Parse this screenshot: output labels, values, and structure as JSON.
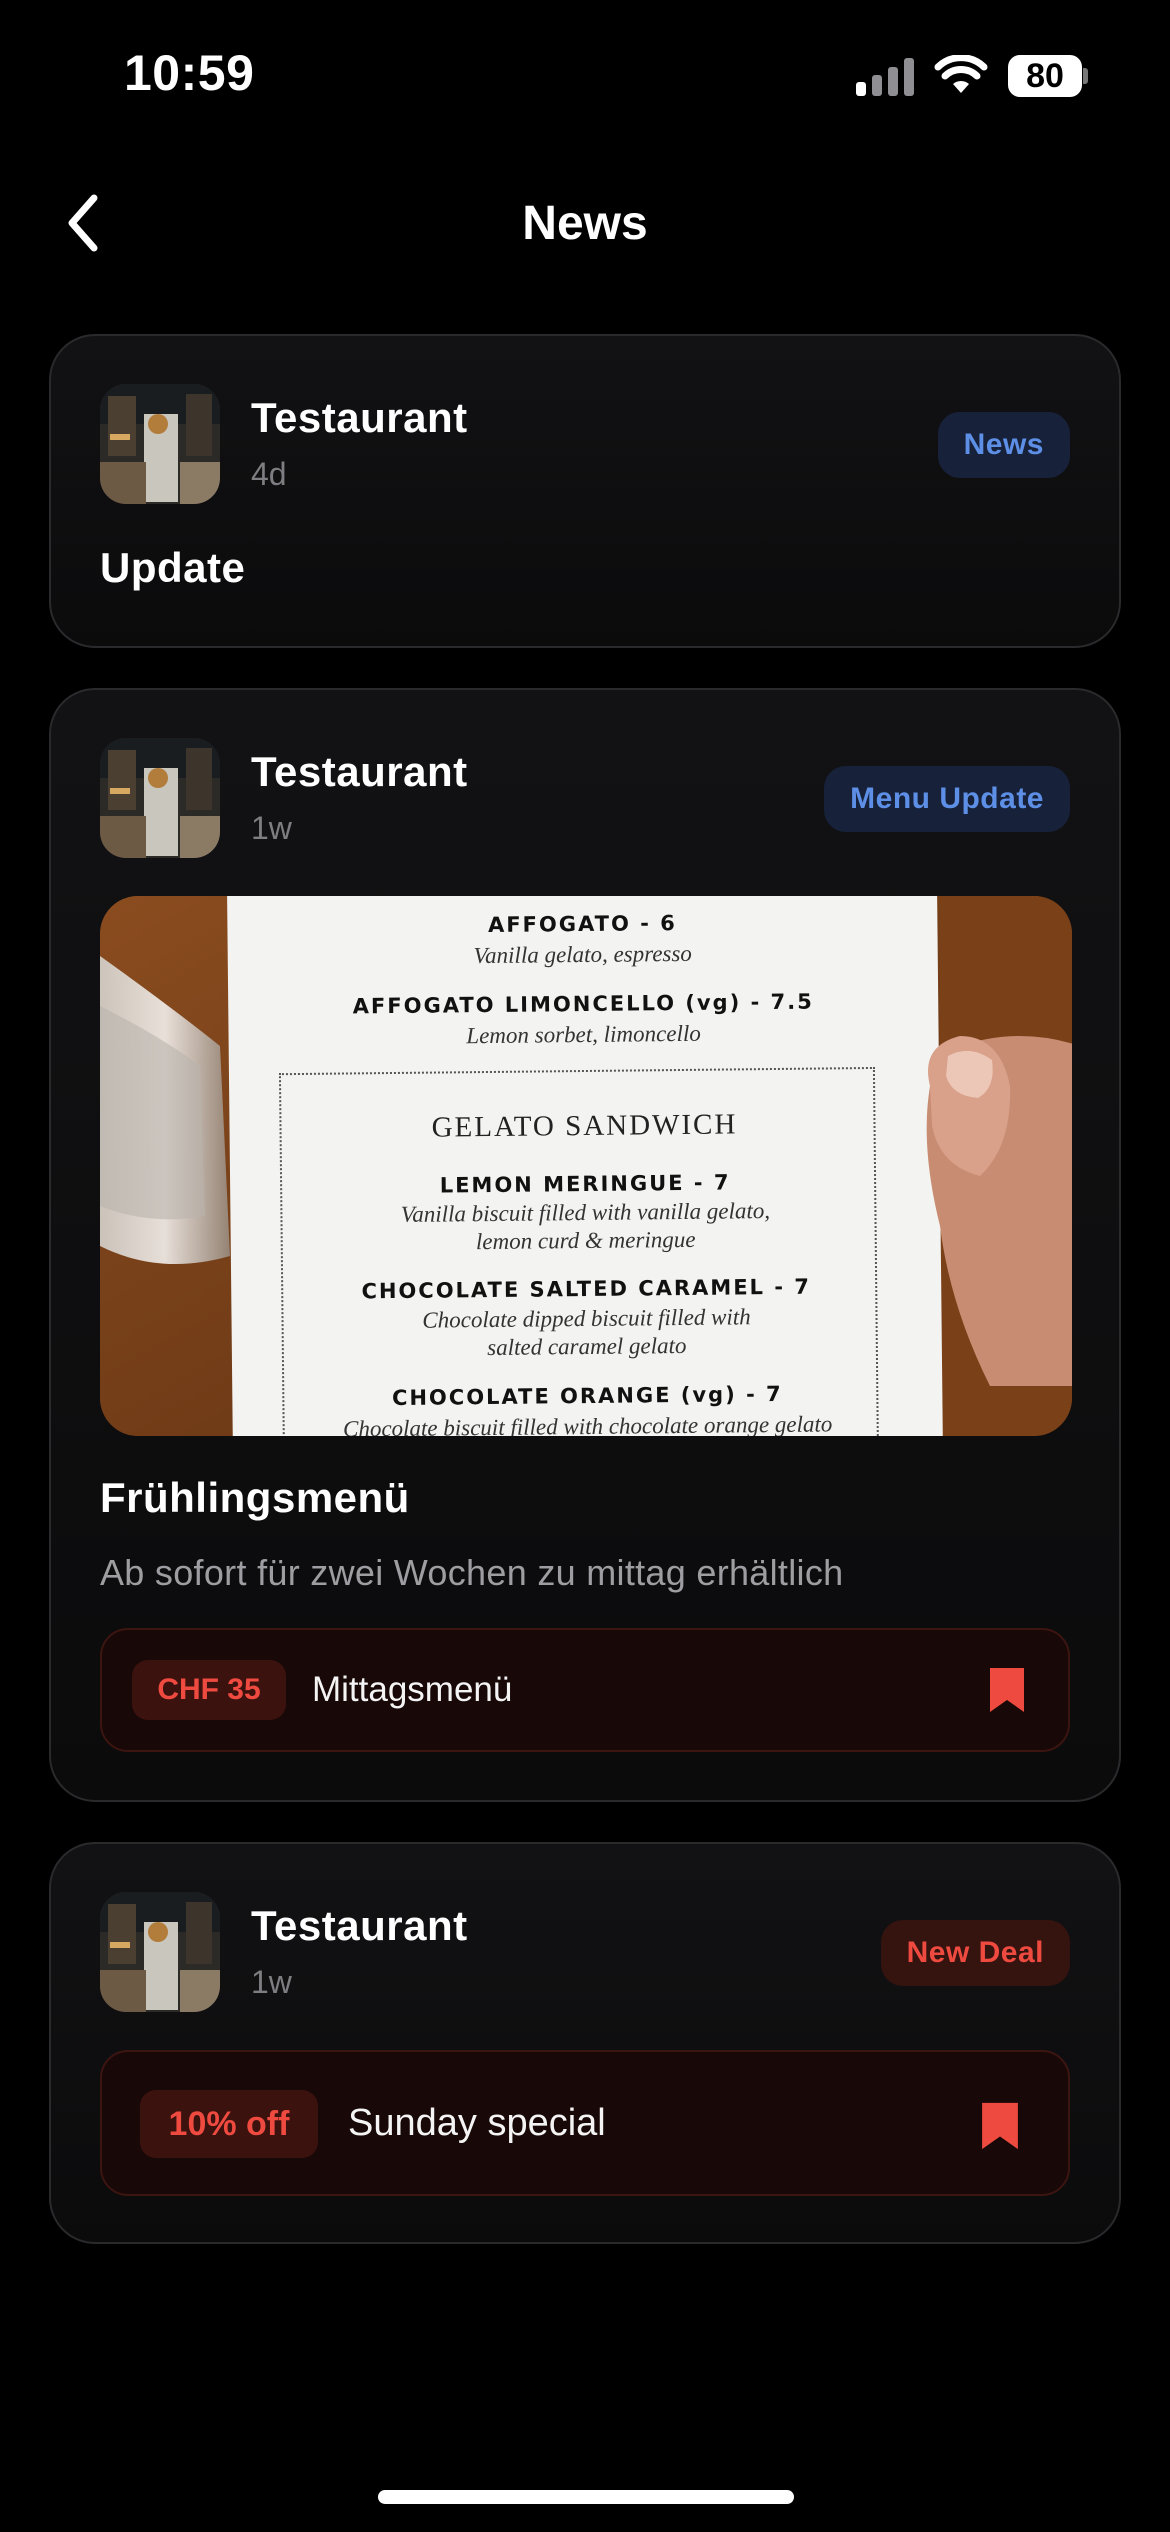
{
  "status_bar": {
    "time": "10:59",
    "battery": "80"
  },
  "nav": {
    "title": "News"
  },
  "posts": [
    {
      "source": "Testaurant",
      "time": "4d",
      "badge": "News",
      "title": "Update"
    },
    {
      "source": "Testaurant",
      "time": "1w",
      "badge": "Menu Update",
      "image_text": {
        "item1_name": "AFFOGATO - 6",
        "item1_desc": "Vanilla gelato, espresso",
        "item2_name": "AFFOGATO LIMONCELLO (vg) - 7.5",
        "item2_desc": "Lemon sorbet, limoncello",
        "section": "GELATO SANDWICH",
        "item3_name": "LEMON MERINGUE - 7",
        "item3_desc1": "Vanilla biscuit filled with vanilla gelato,",
        "item3_desc2": "lemon curd & meringue",
        "item4_name": "CHOCOLATE SALTED CARAMEL - 7",
        "item4_desc1": "Chocolate dipped biscuit filled with",
        "item4_desc2": "salted caramel gelato",
        "item5_name": "CHOCOLATE ORANGE (vg) - 7",
        "item5_desc": "Chocolate biscuit filled with chocolate orange gelato"
      },
      "title": "Frühlingsmenü",
      "description": "Ab sofort für zwei Wochen zu mittag erhältlich",
      "offer": {
        "price": "CHF 35",
        "label": "Mittagsmenü"
      }
    },
    {
      "source": "Testaurant",
      "time": "1w",
      "badge": "New Deal",
      "offer": {
        "price": "10% off",
        "label": "Sunday special"
      }
    }
  ],
  "colors": {
    "background": "#000000",
    "card_border": "#2a2a2d",
    "badge_blue": "#5d8fe6",
    "badge_red": "#ee4a3f",
    "offer_bg": "#180807"
  },
  "icons": [
    "back-chevron-icon",
    "signal-icon",
    "wifi-icon",
    "battery-icon",
    "bookmark-icon"
  ]
}
